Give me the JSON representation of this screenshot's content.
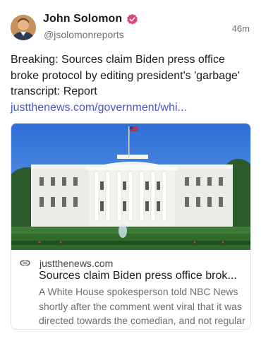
{
  "post": {
    "author": {
      "name": "John Solomon",
      "handle": "@jsolomonreports",
      "verified": true,
      "avatar_icon": "person-avatar"
    },
    "timestamp": "46m",
    "text": "Breaking: Sources claim Biden press office broke protocol by editing president's 'garbage' transcript: Report ",
    "link_text": "justthenews.com/government/whi...",
    "colors": {
      "accent": "#4a57c9",
      "verified_badge": "#e4427d"
    }
  },
  "link_card": {
    "image": "white-house-photo",
    "link_icon": "link-icon",
    "domain": "justthenews.com",
    "title": "Sources claim Biden press office brok...",
    "description": "A White House spokesperson told NBC News shortly after the comment went viral that it was directed towards the comedian, and not regular Trump supporters."
  }
}
